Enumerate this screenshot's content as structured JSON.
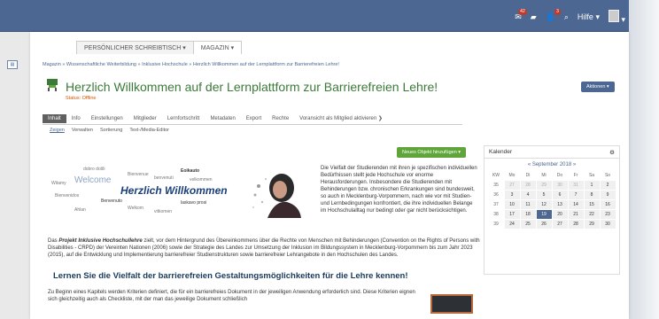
{
  "topbar": {
    "mail_count": "42",
    "user_count": "3",
    "help_label": "Hilfe",
    "colors": {
      "bar": "#4c6791"
    }
  },
  "main_nav": [
    "PERSÖNLICHER SCHREIBTISCH ▾",
    "MAGAZIN ▾"
  ],
  "breadcrumb": "Magazin » Wissenschaftliche Weiterbildung » Inklusive Hochschule » Herzlich Willkommen auf der Lernplattform zur Barrierefreien Lehre!",
  "page": {
    "title": "Herzlich Willkommen auf der Lernplattform zur Barrierefreien Lehre!",
    "status": "Status: Offline",
    "actions_label": "Aktionen ▾"
  },
  "tabs": [
    "Inhalt",
    "Info",
    "Einstellungen",
    "Mitglieder",
    "Lernfortschritt",
    "Metadaten",
    "Export",
    "Rechte",
    "Voransicht als Mitglied aktivieren ❯"
  ],
  "subtabs": [
    "Zeigen",
    "Verwalten",
    "Sortierung",
    "Text-/Media-Editor"
  ],
  "new_object_label": "Neues Objekt hinzufügen ▾",
  "banner": {
    "main_word": "Herzlich Willkommen",
    "welcome_word": "Welcome",
    "small_words": [
      "dobro došli",
      "Bienvenue",
      "Eoikauto",
      "Witamy",
      "benvenuti",
      "velkommen",
      "Benvenuto",
      "Bienvenidos",
      "laskavo prosi",
      "vitkomen",
      "Ahlan",
      "Welkom"
    ]
  },
  "intro_text": "Die Vielfalt der Studierenden mit ihren je spezifischen individuellen Bedürfnissen stellt jede Hochschule vor enorme Herausforderungen. Insbesondere die Studierenden mit Behinderungen bzw. chronischen Erkrankungen sind bundesweit, so auch in Mecklenburg-Vorpommern, nach wie vor mit Studien- und Lernbedingungen konfrontiert, die ihre individuellen Belange im Hochschulalltag nur bedingt oder gar nicht berücksichtigen.",
  "project_text": {
    "prefix": "Das ",
    "name": "Projekt Inklusive Hochschullehre",
    "rest": " zielt, vor dem Hintergrund des Übereinkommens über die Rechte von Menschen mit Behinderungen (Convention on the Rights of Persons with Disabilities - CRPD) der Vereinten Nationen (2006) sowie der Strategie des Landes zur Umsetzung der Inklusion im Bildungssystem in Mecklenburg-Vorpommern bis zum Jahr 2023 (2015), auf die Entwicklung und Implementierung barrierefreier Studienstrukturen sowie barrierefreier Lehrangebote in den Hochschulen des Landes."
  },
  "section2": {
    "heading": "Lernen Sie die Vielfalt der barrierefreien Gestaltungsmöglichkeiten für die Lehre kennen!",
    "body": "Zu Beginn eines Kapitels werden Kriterien definiert, die für ein barrierefreies Dokument in der jeweiligen Anwendung erforderlich sind. Diese Kriterien eignen sich gleichzeitig auch als Checkliste, mit der man das jeweilige Dokument schließlich"
  },
  "calendar": {
    "title": "Kalender",
    "month": "« September 2018 »",
    "headers": [
      "KW",
      "Mo",
      "Di",
      "Mi",
      "Do",
      "Fr",
      "Sa",
      "So"
    ],
    "rows": [
      [
        "35",
        "27",
        "28",
        "29",
        "30",
        "31",
        "1",
        "2"
      ],
      [
        "36",
        "3",
        "4",
        "5",
        "6",
        "7",
        "8",
        "9"
      ],
      [
        "37",
        "10",
        "11",
        "12",
        "13",
        "14",
        "15",
        "16"
      ],
      [
        "38",
        "17",
        "18",
        "19",
        "20",
        "21",
        "22",
        "23"
      ],
      [
        "39",
        "24",
        "25",
        "26",
        "27",
        "28",
        "29",
        "30"
      ]
    ],
    "today": "19"
  }
}
